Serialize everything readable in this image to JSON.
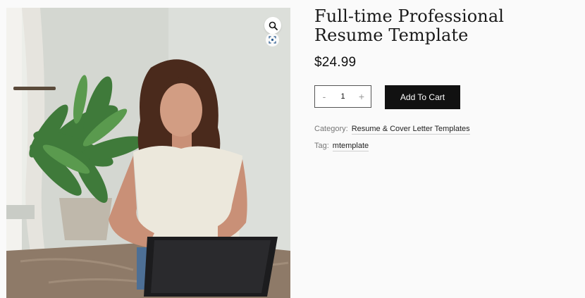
{
  "product": {
    "title": "Full-time Professional Resume Template",
    "price": "$24.99"
  },
  "quantity": {
    "value": "1",
    "decrement_label": "-",
    "increment_label": "+"
  },
  "actions": {
    "add_to_cart_label": "Add To Cart"
  },
  "meta": {
    "category_label": "Category:",
    "category_value": "Resume & Cover Letter Templates",
    "tag_label": "Tag:",
    "tag_value": "mtemplate"
  },
  "gallery": {
    "zoom_icon": "magnifier-icon",
    "scan_icon": "scan-icon"
  },
  "colors": {
    "background": "#fafafa",
    "button": "#111111",
    "button_text": "#ffffff",
    "meta_text": "#777777"
  }
}
